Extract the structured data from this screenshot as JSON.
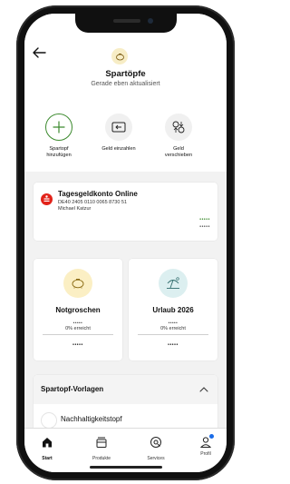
{
  "header": {
    "title": "Spartöpfe",
    "subtitle": "Gerade eben aktualisiert",
    "badge_icon": "piggy-bank-icon"
  },
  "actions": [
    {
      "label": "Spartopf\nhinzufügen",
      "icon": "plus-icon"
    },
    {
      "label": "Geld einzahlen",
      "icon": "deposit-card-icon"
    },
    {
      "label": "Geld\nverschieben",
      "icon": "move-money-icon"
    }
  ],
  "account": {
    "name": "Tagesgeldkonto Online",
    "iban": "DE40 2405 0110 0065 8730 51",
    "owner": "Michael Katzur",
    "balance_masked": "•••••",
    "balance_masked_2": "•••••",
    "bank_icon": "sparkasse-logo-icon"
  },
  "pots": [
    {
      "name": "Notgroschen",
      "masked": "•••••",
      "progress_text": "0% erreicht",
      "progress_fraction": 0,
      "amount_masked": "•••••",
      "icon": "piggy-bank-icon",
      "icon_bg": "#fbefc4"
    },
    {
      "name": "Urlaub 2026",
      "masked": "•••••",
      "progress_text": "0% erreicht",
      "progress_fraction": 0,
      "amount_masked": "•••••",
      "icon": "beach-umbrella-icon",
      "icon_bg": "#dceff0"
    }
  ],
  "templates": {
    "title": "Spartopf-Vorlagen",
    "first_item": "Nachhaltigkeitstopf"
  },
  "tabbar": {
    "items": [
      {
        "label": "Start",
        "icon": "home-icon",
        "active": true
      },
      {
        "label": "Produkte",
        "icon": "products-icon",
        "active": false
      },
      {
        "label": "Services",
        "icon": "services-icon",
        "active": false
      },
      {
        "label": "Profil",
        "icon": "profile-icon",
        "active": false
      }
    ]
  },
  "colors": {
    "accent_green": "#3c8a2e",
    "bank_red": "#e2231a",
    "notification_blue": "#1a6ce8"
  }
}
